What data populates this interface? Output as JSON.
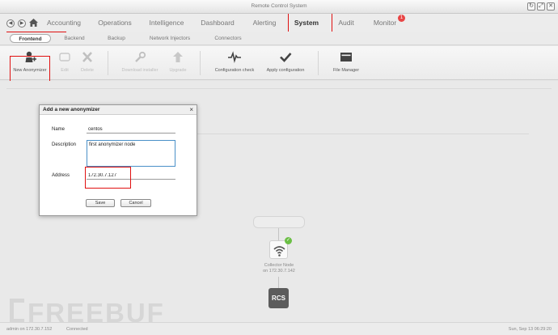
{
  "window": {
    "title": "Remote Control System",
    "controls": [
      "↻",
      "⤢",
      "✕"
    ]
  },
  "main_nav": {
    "back": "◀",
    "forward": "▶",
    "tabs": [
      {
        "label": "Accounting",
        "active": false
      },
      {
        "label": "Operations",
        "active": false
      },
      {
        "label": "Intelligence",
        "active": false
      },
      {
        "label": "Dashboard",
        "active": false
      },
      {
        "label": "Alerting",
        "active": false
      },
      {
        "label": "System",
        "active": true
      },
      {
        "label": "Audit",
        "active": false
      },
      {
        "label": "Monitor",
        "active": false,
        "badge": "1"
      }
    ]
  },
  "sub_nav": {
    "tabs": [
      {
        "label": "Frontend",
        "active": true
      },
      {
        "label": "Backend",
        "active": false
      },
      {
        "label": "Backup",
        "active": false
      },
      {
        "label": "Network Injectors",
        "active": false
      },
      {
        "label": "Connectors",
        "active": false
      }
    ]
  },
  "toolbar": {
    "buttons": [
      {
        "label": "New Anonymizer",
        "icon": "anonymizer-add-icon",
        "enabled": true
      },
      {
        "label": "Edit",
        "icon": "edit-icon",
        "enabled": false
      },
      {
        "label": "Delete",
        "icon": "delete-icon",
        "enabled": false
      },
      {
        "label": "Download installer",
        "icon": "wrench-icon",
        "enabled": false
      },
      {
        "label": "Upgrade",
        "icon": "upgrade-arrow-icon",
        "enabled": false
      },
      {
        "label": "Configuration check",
        "icon": "pulse-icon",
        "enabled": true
      },
      {
        "label": "Apply configuration",
        "icon": "checkmark-icon",
        "enabled": true
      },
      {
        "label": "File Manager",
        "icon": "folder-icon",
        "enabled": true
      }
    ]
  },
  "dialog": {
    "title": "Add a new anonymizer",
    "close": "×",
    "fields": {
      "name": {
        "label": "Name",
        "value": "centos"
      },
      "description": {
        "label": "Description",
        "value": "first anonymizer node"
      },
      "address": {
        "label": "Address",
        "value": "172.30.7.127"
      }
    },
    "save_label": "Save",
    "cancel_label": "Cancel"
  },
  "network": {
    "collector_label": "Collector Node",
    "collector_address": "on 172.30.7.142",
    "collector_status_icon": "✓",
    "rcs_label": "RCS"
  },
  "status": {
    "user": "admin on 172.30.7.152",
    "connection": "Connected",
    "datetime": "Sun, Sep 13 06:29:20"
  },
  "watermark": {
    "text": "FREEBUF"
  },
  "colors": {
    "highlight": "#e01010",
    "active_text": "#333333",
    "badge": "#e84545",
    "ok": "#6bbf45",
    "focus": "#4a90c8"
  }
}
